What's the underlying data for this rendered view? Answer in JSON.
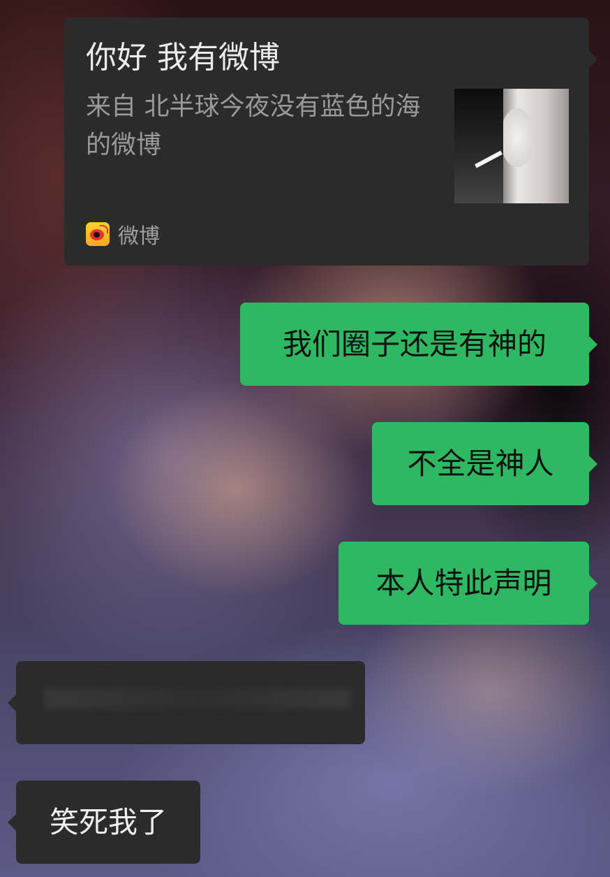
{
  "share_card": {
    "title": "你好 我有微博",
    "description": "来自 北半球今夜没有蓝色的海 的微博",
    "source": "微博",
    "source_icon": "weibo-icon"
  },
  "messages": [
    {
      "side": "right",
      "text": "我们圈子还是有神的"
    },
    {
      "side": "right",
      "text": "不全是神人"
    },
    {
      "side": "right",
      "text": "本人特此声明"
    },
    {
      "side": "left",
      "text": ""
    },
    {
      "side": "left",
      "text": "笑死我了"
    }
  ],
  "colors": {
    "outgoing_bubble": "#2fb861",
    "incoming_bubble": "#2b2b2b"
  }
}
